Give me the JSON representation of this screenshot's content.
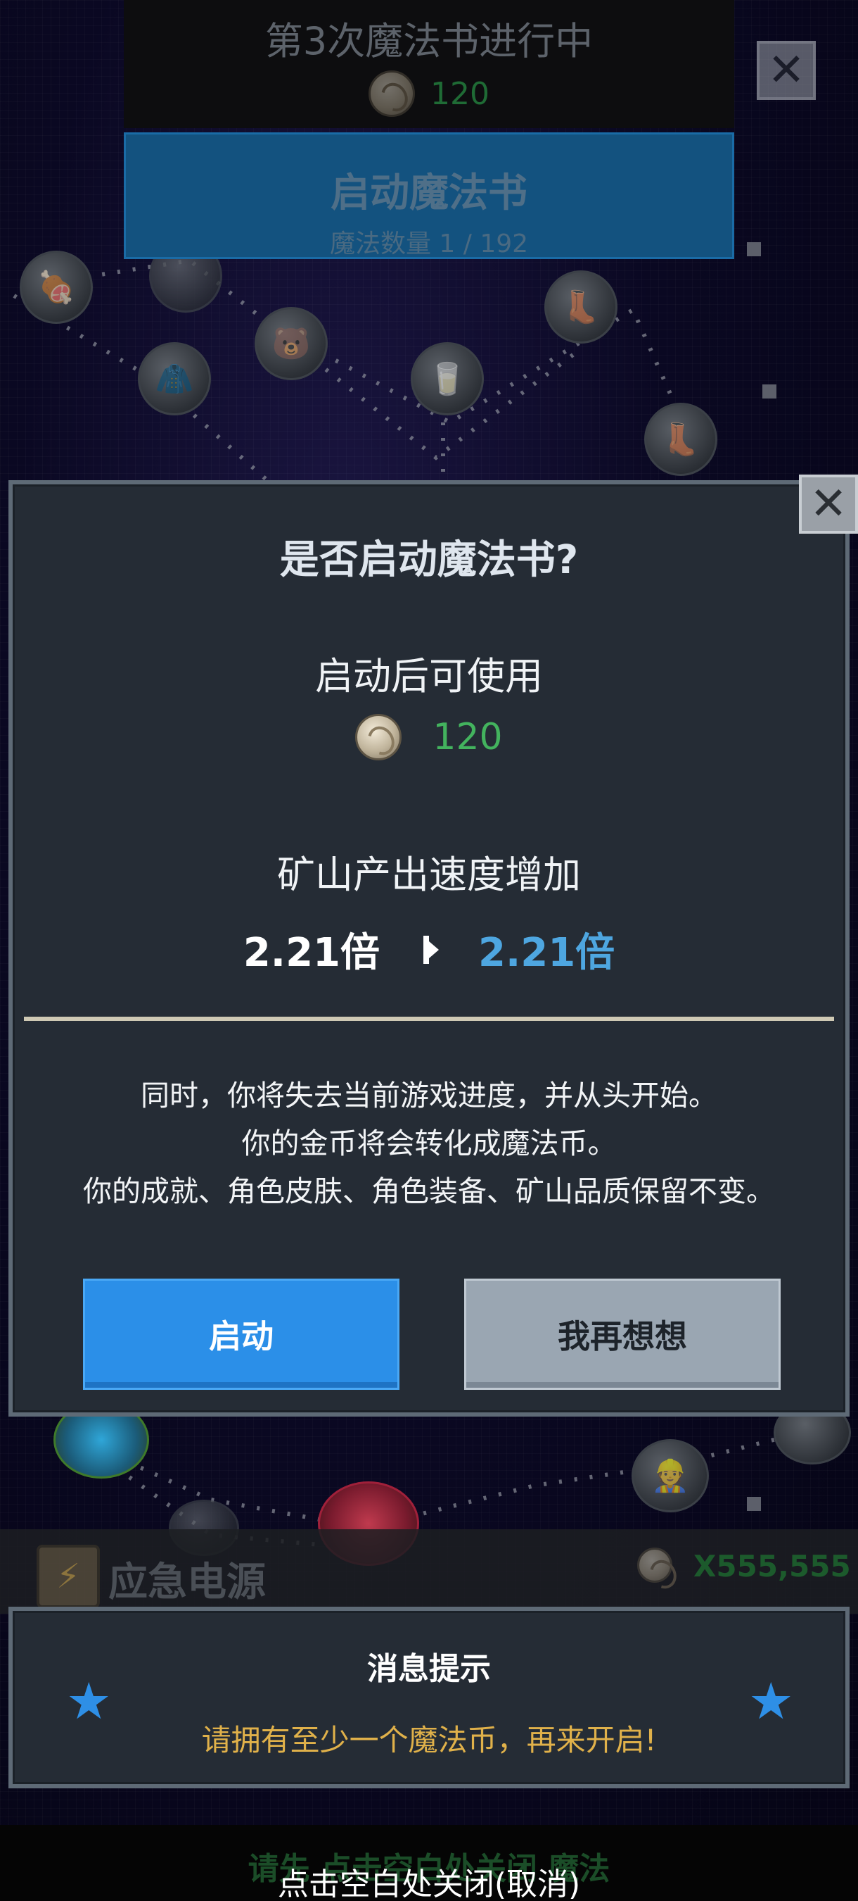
{
  "book_status": {
    "title": "第3次魔法书进行中",
    "cost_icon": "magic-coin-icon",
    "cost_value": "120",
    "start_button_label": "启动魔法书",
    "magic_count": "魔法数量 1 / 192"
  },
  "emergency": {
    "label": "应急电源",
    "icon": "battery-icon",
    "amount": "X555,555"
  },
  "dialog": {
    "title": "是否启动魔法书?",
    "after_start_label": "启动后可使用",
    "cost_value": "120",
    "speed_label": "矿山产出速度增加",
    "speed_current": "2.21倍",
    "speed_next": "2.21倍",
    "notice_lines": [
      "同时，你将失去当前游戏进度，并从头开始。",
      "你的金币将会转化成魔法币。",
      "你的成就、角色皮肤、角色装备、矿山品质保留不变。"
    ],
    "confirm_label": "启动",
    "cancel_label": "我再想想",
    "close_icon": "close-icon"
  },
  "toast": {
    "title": "消息提示",
    "message": "请拥有至少一个魔法币，再来开启!",
    "star_icon": "star-icon"
  },
  "footer": {
    "hint_behind": "请先 点击空白处关闭 魔法",
    "close_hint": "点击空白处关闭(取消)"
  },
  "colors": {
    "accent_blue": "#2b8fe8",
    "coin_green": "#43b35e",
    "speed_blue": "#4ea6e0",
    "warning_gold": "#e0b14a",
    "panel_bg": "#252c35"
  }
}
